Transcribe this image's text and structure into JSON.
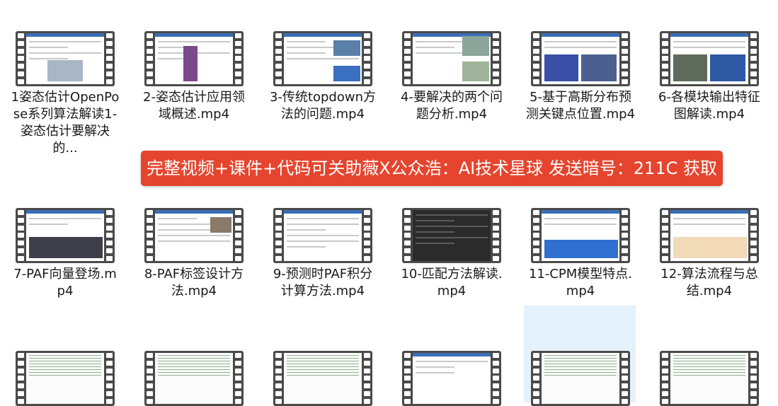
{
  "banner": {
    "text": "完整视频+课件+代码可关助薇X公众浩：AI技术星球 发送暗号：211C 获取",
    "color": "#e5452e"
  },
  "files": [
    {
      "label": "1姿态估计OpenPose系列算法解读1-姿态估计要解决的..."
    },
    {
      "label": "2-姿态估计应用领域概述.mp4"
    },
    {
      "label": "3-传统topdown方法的问题.mp4"
    },
    {
      "label": "4-要解决的两个问题分析.mp4"
    },
    {
      "label": "5-基于高斯分布预测关键点位置.mp4"
    },
    {
      "label": "6-各模块输出特征图解读.mp4"
    },
    {
      "label": "7-PAF向量登场.mp4"
    },
    {
      "label": "8-PAF标签设计方法.mp4"
    },
    {
      "label": "9-预测时PAF积分计算方法.mp4"
    },
    {
      "label": "10-匹配方法解读.mp4"
    },
    {
      "label": "11-CPM模型特点.mp4"
    },
    {
      "label": "12-算法流程与总结.mp4"
    }
  ],
  "colors": {
    "selection": "#e5f1fb",
    "film": "#4a4a4a"
  }
}
